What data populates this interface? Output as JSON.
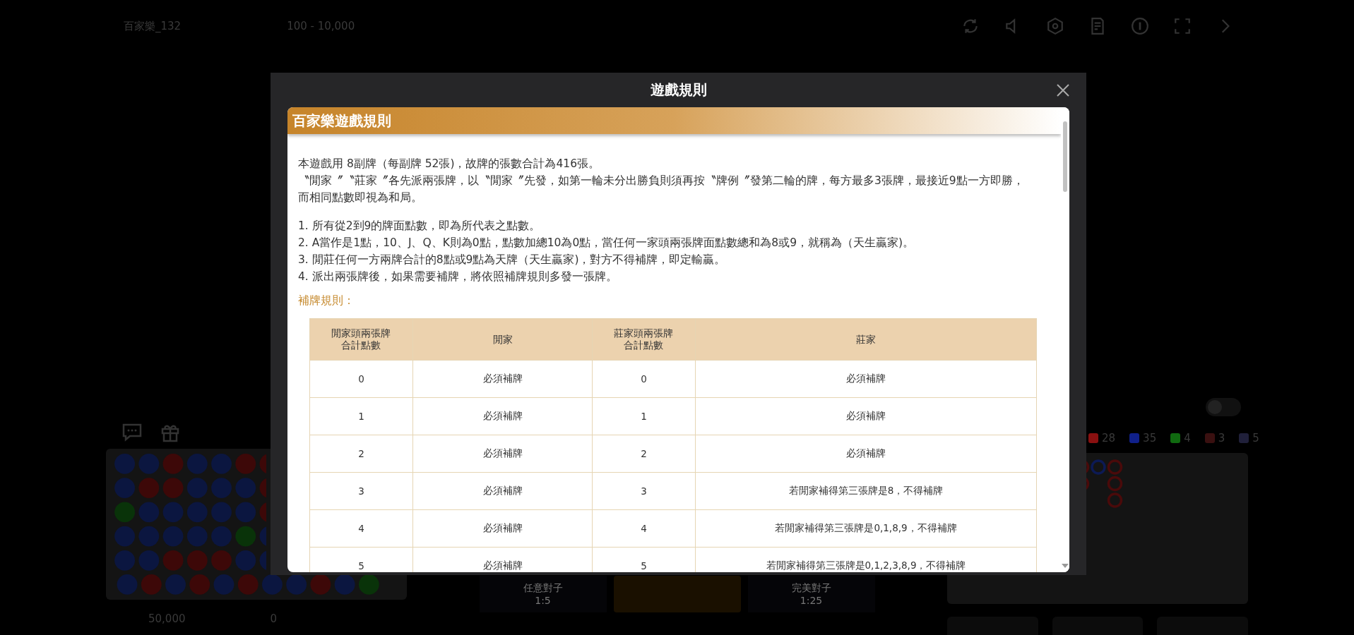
{
  "top_bar": {
    "table_name": "百家樂_132",
    "bet_range": "100 - 10,000"
  },
  "bet_options": [
    {
      "label": "任意對子",
      "odds": "1:5",
      "highlighted": false
    },
    {
      "label": "完美對子",
      "odds": "1:25",
      "highlighted": false
    }
  ],
  "stats": [
    {
      "count": "28",
      "color": "#8a1010"
    },
    {
      "count": "35",
      "color": "#10208a"
    },
    {
      "count": "4",
      "color": "#106a10"
    },
    {
      "count": "3",
      "color": "#3a1010"
    },
    {
      "count": "5",
      "color": "#20203a"
    }
  ],
  "toggle": {
    "on": false
  },
  "balance": {
    "amount": "50,000",
    "bet": "0"
  },
  "modal": {
    "title": "遊戲規則",
    "heading": "百家樂遊戲規則",
    "intro": [
      "本遊戲用 8副牌（每副牌 52張)，故牌的張數合計為416張。",
      "〝閒家〞〝莊家〞各先派兩張牌，以〝閒家〞先發，如第一輪未分出勝負則須再按〝牌例〞發第二輪的牌，每方最多3張牌，最接近9點一方即勝，而相同點數即視為和局。"
    ],
    "rules": [
      "1. 所有從2到9的牌面點數，即為所代表之點數。",
      "2. A當作是1點，10、J、Q、K則為0點，點數加總10為0點，當任何一家頭兩張牌面點數總和為8或9，就稱為（天生贏家)。",
      "3. 閒莊任何一方兩牌合計的8點或9點為天牌（天生贏家)，對方不得補牌，即定輸贏。",
      "4. 派出兩張牌後，如果需要補牌，將依照補牌規則多發一張牌。"
    ],
    "subheading": "補牌規則：",
    "table": {
      "columns": [
        "閒家頭兩張牌合計點數",
        "閒家",
        "莊家頭兩張牌合計點數",
        "莊家"
      ],
      "rows": [
        [
          "0",
          "必須補牌",
          "0",
          "必須補牌"
        ],
        [
          "1",
          "必須補牌",
          "1",
          "必須補牌"
        ],
        [
          "2",
          "必須補牌",
          "2",
          "必須補牌"
        ],
        [
          "3",
          "必須補牌",
          "3",
          "若閒家補得第三張牌是8，不得補牌"
        ],
        [
          "4",
          "必須補牌",
          "4",
          "若閒家補得第三張牌是0,1,8,9，不得補牌"
        ],
        [
          "5",
          "必須補牌",
          "5",
          "若閒家補得第三張牌是0,1,2,3,8,9，不得補牌"
        ]
      ]
    }
  }
}
